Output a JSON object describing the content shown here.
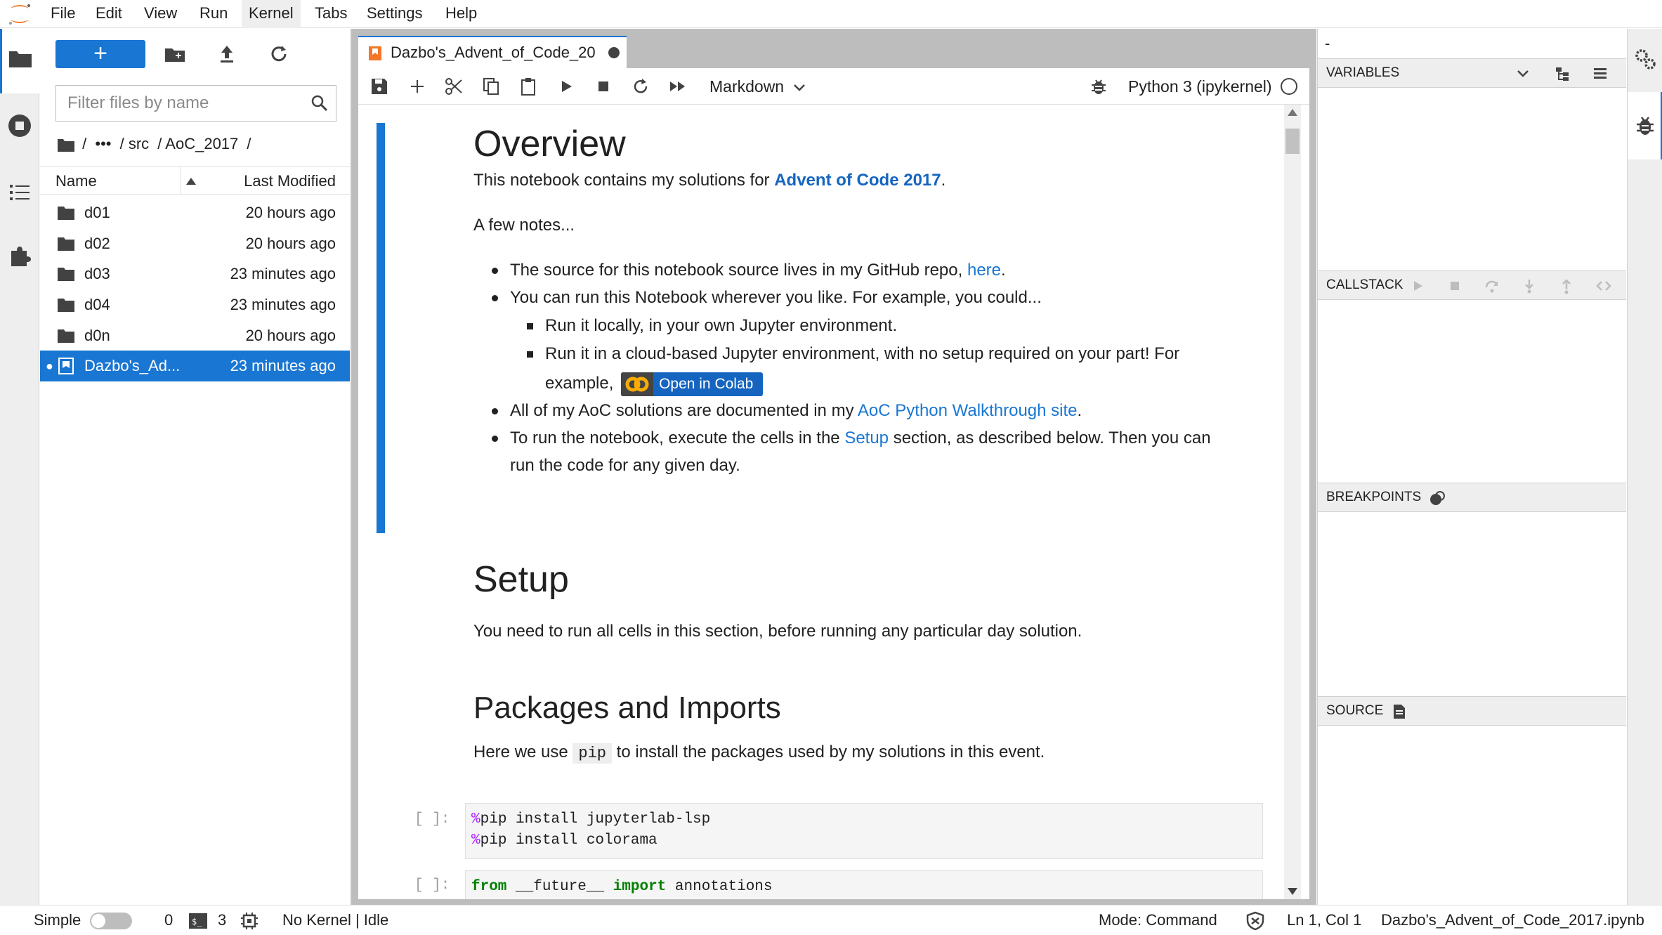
{
  "menubar": {
    "items": [
      "File",
      "Edit",
      "View",
      "Run",
      "Kernel",
      "Tabs",
      "Settings",
      "Help"
    ],
    "active": "Kernel"
  },
  "filebrowser": {
    "new_label": "+",
    "filter_placeholder": "Filter files by name",
    "breadcrumb": [
      "/",
      "•••",
      "/ src",
      "/ AoC_2017",
      "/"
    ],
    "columns": {
      "name": "Name",
      "modified": "Last Modified"
    },
    "files": [
      {
        "name": "d01",
        "modified": "20 hours ago",
        "type": "folder"
      },
      {
        "name": "d02",
        "modified": "20 hours ago",
        "type": "folder"
      },
      {
        "name": "d03",
        "modified": "23 minutes ago",
        "type": "folder"
      },
      {
        "name": "d04",
        "modified": "23 minutes ago",
        "type": "folder"
      },
      {
        "name": "d0n",
        "modified": "20 hours ago",
        "type": "folder"
      },
      {
        "name": "Dazbo's_Ad...",
        "modified": "23 minutes ago",
        "type": "notebook",
        "selected": true
      }
    ]
  },
  "notebook": {
    "tab_label": "Dazbo's_Advent_of_Code_20",
    "cell_type": "Markdown",
    "kernel_name": "Python 3 (ipykernel)",
    "content": {
      "h_overview": "Overview",
      "p_intro_before": "This notebook contains my solutions for ",
      "p_intro_link": "Advent of Code 2017",
      "p_intro_after": ".",
      "p_notes": "A few notes...",
      "b1_before": "The source for this notebook source lives in my GitHub repo, ",
      "b1_link": "here",
      "b1_after": ".",
      "b2": "You can run this Notebook wherever you like. For example, you could...",
      "b2a": "Run it locally, in your own Jupyter environment.",
      "b2b_line1": "Run it in a cloud-based Jupyter environment, with no setup required on your part! For",
      "b2b_line2": "example, ",
      "colab_badge": "Open in Colab",
      "b3_before": "All of my AoC solutions are documented in my ",
      "b3_link": "AoC Python Walkthrough site",
      "b3_after": ".",
      "b4_before": "To run the notebook, execute the cells in the ",
      "b4_link": "Setup",
      "b4_after": " section, as described below. Then you can",
      "b4_line2": "run the code for any given day.",
      "h_setup": "Setup",
      "p_setup": "You need to run all cells in this section, before running any particular day solution.",
      "h_packages": "Packages and Imports",
      "p_pkg_before": "Here we use ",
      "p_pkg_code": "pip",
      "p_pkg_after": " to install the packages used by my solutions in this event.",
      "cell1_prompt": "[ ]:",
      "cell1_line1_magic": "%",
      "cell1_line1_rest": "pip install jupyterlab-lsp",
      "cell1_line2_magic": "%",
      "cell1_line2_rest": "pip install colorama",
      "cell2_prompt": "[ ]:",
      "cell2_kw1": "from",
      "cell2_mid": " __future__ ",
      "cell2_kw2": "import",
      "cell2_rest": " annotations"
    }
  },
  "debugger": {
    "title": "-",
    "sections": {
      "variables": "VARIABLES",
      "callstack": "CALLSTACK",
      "breakpoints": "BREAKPOINTS",
      "source": "SOURCE"
    }
  },
  "statusbar": {
    "mode_label": "Simple",
    "count_a": "0",
    "count_b": "3",
    "kernel_status": "No Kernel | Idle",
    "mode": "Mode: Command",
    "position": "Ln 1, Col 1",
    "filename": "Dazbo's_Advent_of_Code_2017.ipynb"
  },
  "colors": {
    "accent": "#1976d2",
    "jupyter_orange": "#f37726",
    "colab_orange": "#f9ab00"
  }
}
